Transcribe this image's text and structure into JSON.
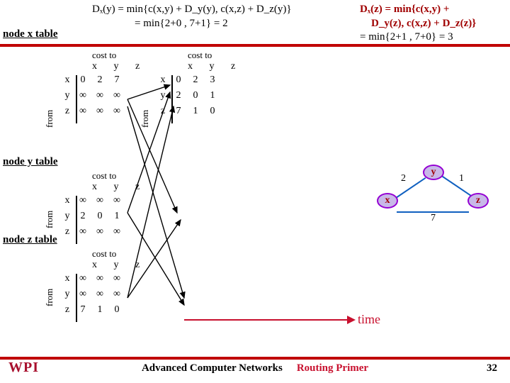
{
  "eq1_l1": "Dₓ(y) = min{c(x,y) + D_y(y), c(x,z) + D_z(y)}",
  "eq1_l2": "= min{2+0 , 7+1} = 2",
  "eq2_l1": "Dₓ(z) = min{c(x,y) +",
  "eq2_l2": "D_y(z), c(x,z) + D_z(z)}",
  "eq2_l3": "= min{2+1 , 7+0} = 3",
  "lbl_node_x": "node x table",
  "lbl_node_y": "node y table",
  "lbl_node_z": "node z table",
  "cost_to": "cost to",
  "cols": "x  y  z",
  "from": "from",
  "rlab": [
    "x",
    "y",
    "z"
  ],
  "tx": {
    "r0": [
      "0",
      "2",
      "7"
    ],
    "r1": [
      "∞",
      "∞",
      "∞"
    ],
    "r2": [
      "∞",
      "∞",
      "∞"
    ]
  },
  "txb": {
    "r0": [
      "0",
      "2",
      "3"
    ],
    "r1": [
      "2",
      "0",
      "1"
    ],
    "r2": [
      "7",
      "1",
      "0"
    ]
  },
  "ty": {
    "r0": [
      "∞",
      "∞",
      "∞"
    ],
    "r1": [
      "2",
      "0",
      "1"
    ],
    "r2": [
      "∞",
      "∞",
      "∞"
    ]
  },
  "tz": {
    "r0": [
      "∞",
      "∞",
      "∞"
    ],
    "r1": [
      "∞",
      "∞",
      "∞"
    ],
    "r2": [
      "7",
      "1",
      "0"
    ]
  },
  "graph": {
    "x": "x",
    "y": "y",
    "z": "z",
    "wxy": "2",
    "wyz": "1",
    "wxz": "7"
  },
  "time": "time",
  "footer_a": "Advanced Computer Networks",
  "footer_b": "Routing Primer",
  "slide": "32",
  "logo": "WPI"
}
